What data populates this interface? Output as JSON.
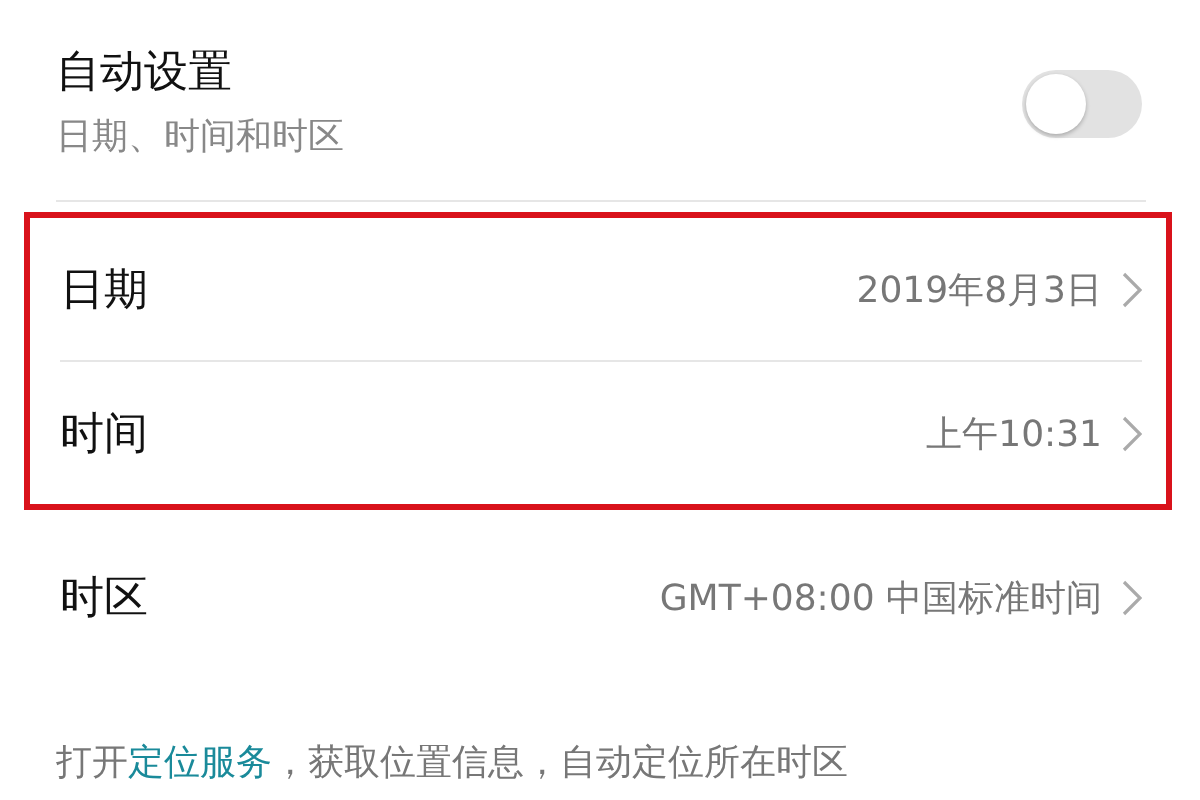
{
  "auto_setting": {
    "title": "自动设置",
    "subtitle": "日期、时间和时区",
    "on": false
  },
  "sections": [
    {
      "highlighted": true,
      "rows": [
        {
          "label": "日期",
          "value": "2019年8月3日"
        },
        {
          "label": "时间",
          "value": "上午10:31"
        }
      ]
    },
    {
      "highlighted": false,
      "rows": [
        {
          "label": "时区",
          "value": "GMT+08:00 中国标准时间"
        }
      ]
    }
  ],
  "footer": {
    "prefix": "打开",
    "link": "定位服务",
    "suffix": "，获取位置信息，自动定位所在时区"
  }
}
